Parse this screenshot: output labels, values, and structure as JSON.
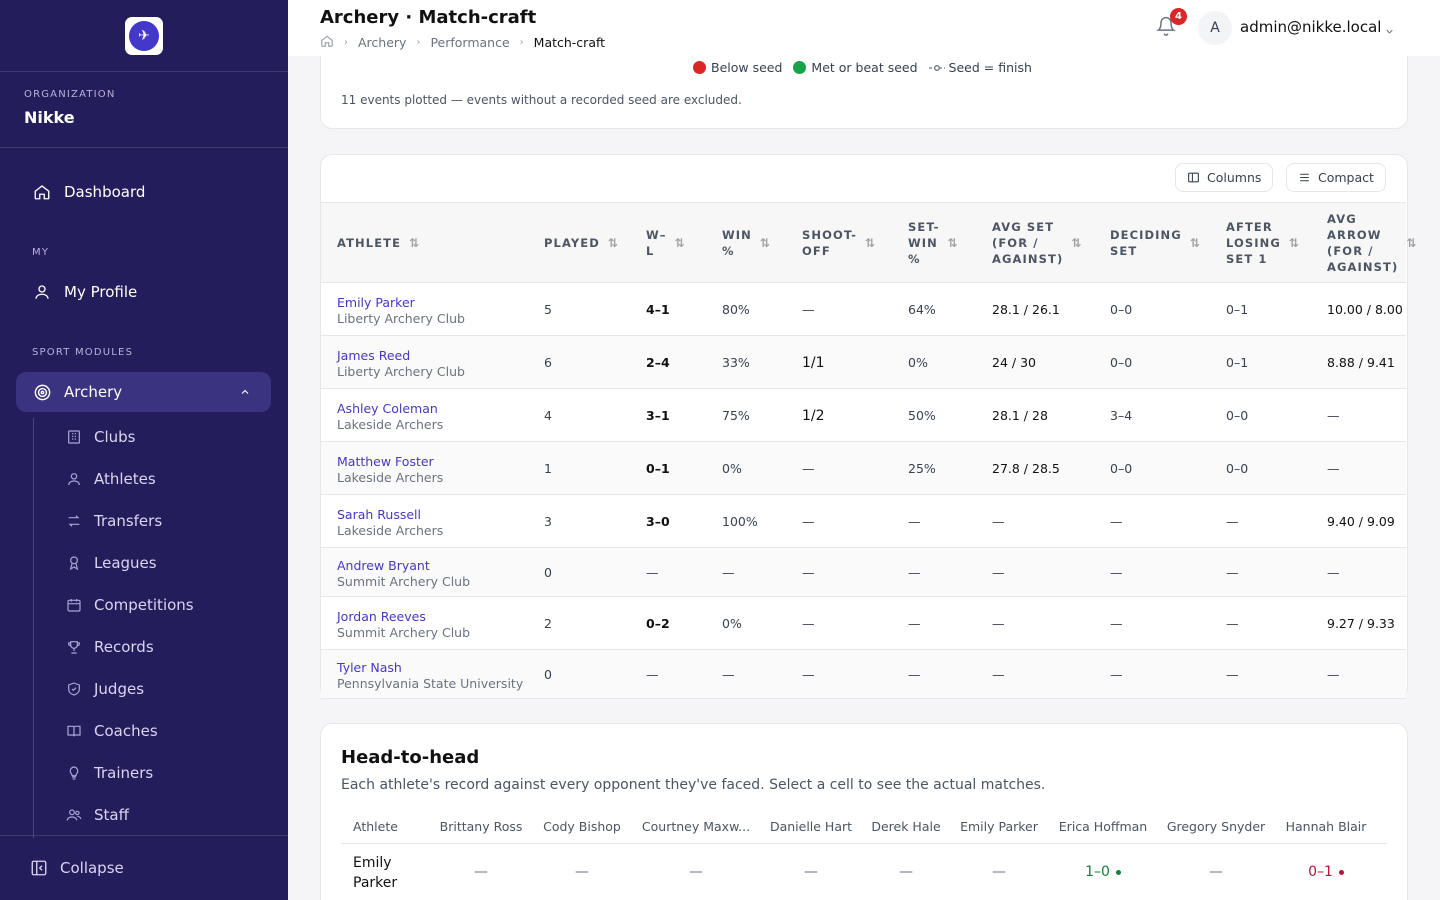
{
  "sidebar": {
    "org_label": "ORGANIZATION",
    "org_name": "Nikke",
    "dashboard": "Dashboard",
    "my_section": "MY",
    "my_profile": "My Profile",
    "sport_section": "SPORT MODULES",
    "archery": "Archery",
    "sub_items": [
      {
        "label": "Clubs",
        "icon": "building-icon"
      },
      {
        "label": "Athletes",
        "icon": "person-icon"
      },
      {
        "label": "Transfers",
        "icon": "arrows-icon"
      },
      {
        "label": "Leagues",
        "icon": "ribbon-icon"
      },
      {
        "label": "Competitions",
        "icon": "calendar-icon"
      },
      {
        "label": "Records",
        "icon": "trophy-icon"
      },
      {
        "label": "Judges",
        "icon": "shield-icon"
      },
      {
        "label": "Coaches",
        "icon": "book-icon"
      },
      {
        "label": "Trainers",
        "icon": "bulb-icon"
      },
      {
        "label": "Staff",
        "icon": "people-icon"
      }
    ],
    "collapse": "Collapse"
  },
  "header": {
    "title": "Archery · Match-craft",
    "breadcrumb": [
      "Archery",
      "Performance",
      "Match-craft"
    ],
    "notifications": "4",
    "avatar_initial": "A",
    "user": "admin@nikke.local"
  },
  "legend": {
    "below": "Below seed",
    "met": "Met or beat seed",
    "seed": "Seed = finish",
    "colors": {
      "below": "#dc2626",
      "met": "#16a34a"
    }
  },
  "note": "11 events plotted — events without a recorded seed are excluded.",
  "table": {
    "columns_btn": "Columns",
    "compact_btn": "Compact",
    "headers": [
      "ATHLETE",
      "PLAYED",
      "W–L",
      "WIN %",
      "SHOOT-OFF",
      "SET-WIN %",
      "AVG SET (FOR / AGAINST)",
      "DECIDING SET",
      "AFTER LOSING SET 1",
      "AVG ARROW (FOR / AGAINST)"
    ],
    "header_lines": [
      [
        "ATHLETE"
      ],
      [
        "PLAYED"
      ],
      [
        "W–",
        "L"
      ],
      [
        "WIN",
        "%"
      ],
      [
        "SHOOT-",
        "OFF"
      ],
      [
        "SET-",
        "WIN",
        "%"
      ],
      [
        "AVG SET",
        "(FOR /",
        "AGAINST)"
      ],
      [
        "DECIDING",
        "SET"
      ],
      [
        "AFTER",
        "LOSING",
        "SET 1"
      ],
      [
        "AVG",
        "ARROW",
        "(FOR /",
        "AGAINST)"
      ]
    ],
    "rows": [
      {
        "name": "Emily Parker",
        "club": "Liberty Archery Club",
        "played": "5",
        "wl": "4–1",
        "win": "80%",
        "shootoff": "—",
        "setwin": "64%",
        "avgset": "28.1 / 26.1",
        "deciding": "0–0",
        "afterlose": "0–1",
        "avgarrow": "10.00 / 8.00"
      },
      {
        "name": "James Reed",
        "club": "Liberty Archery Club",
        "played": "6",
        "wl": "2–4",
        "win": "33%",
        "shootoff": "1/1",
        "setwin": "0%",
        "avgset": "24 / 30",
        "deciding": "0–0",
        "afterlose": "0–1",
        "avgarrow": "8.88 / 9.41"
      },
      {
        "name": "Ashley Coleman",
        "club": "Lakeside Archers",
        "played": "4",
        "wl": "3–1",
        "win": "75%",
        "shootoff": "1/2",
        "setwin": "50%",
        "avgset": "28.1 / 28",
        "deciding": "3–4",
        "afterlose": "0–0",
        "avgarrow": "—"
      },
      {
        "name": "Matthew Foster",
        "club": "Lakeside Archers",
        "played": "1",
        "wl": "0–1",
        "win": "0%",
        "shootoff": "—",
        "setwin": "25%",
        "avgset": "27.8 / 28.5",
        "deciding": "0–0",
        "afterlose": "0–0",
        "avgarrow": "—"
      },
      {
        "name": "Sarah Russell",
        "club": "Lakeside Archers",
        "played": "3",
        "wl": "3–0",
        "win": "100%",
        "shootoff": "—",
        "setwin": "—",
        "avgset": "—",
        "deciding": "—",
        "afterlose": "—",
        "avgarrow": "9.40 / 9.09"
      },
      {
        "name": "Andrew Bryant",
        "club": "Summit Archery Club",
        "played": "0",
        "wl": "—",
        "win": "—",
        "shootoff": "—",
        "setwin": "—",
        "avgset": "—",
        "deciding": "—",
        "afterlose": "—",
        "avgarrow": "—"
      },
      {
        "name": "Jordan Reeves",
        "club": "Summit Archery Club",
        "played": "2",
        "wl": "0–2",
        "win": "0%",
        "shootoff": "—",
        "setwin": "—",
        "avgset": "—",
        "deciding": "—",
        "afterlose": "—",
        "avgarrow": "9.27 / 9.33"
      },
      {
        "name": "Tyler Nash",
        "club": "Pennsylvania State University",
        "played": "0",
        "wl": "—",
        "win": "—",
        "shootoff": "—",
        "setwin": "—",
        "avgset": "—",
        "deciding": "—",
        "afterlose": "—",
        "avgarrow": "—"
      }
    ]
  },
  "h2h": {
    "title": "Head-to-head",
    "subtitle": "Each athlete's record against every opponent they've faced. Select a cell to see the actual matches.",
    "athlete_header": "Athlete",
    "opponents": [
      "Brittany Ross",
      "Cody Bishop",
      "Courtney Maxw...",
      "Danielle Hart",
      "Derek Hale",
      "Emily Parker",
      "Erica Hoffman",
      "Gregory Snyder",
      "Hannah Blair"
    ],
    "row_athlete": "Emily Parker",
    "row_values": [
      "—",
      "—",
      "—",
      "—",
      "—",
      "—",
      "1–0",
      "—",
      "0–1"
    ],
    "row_status": [
      "none",
      "none",
      "none",
      "none",
      "none",
      "none",
      "win",
      "none",
      "loss"
    ]
  }
}
